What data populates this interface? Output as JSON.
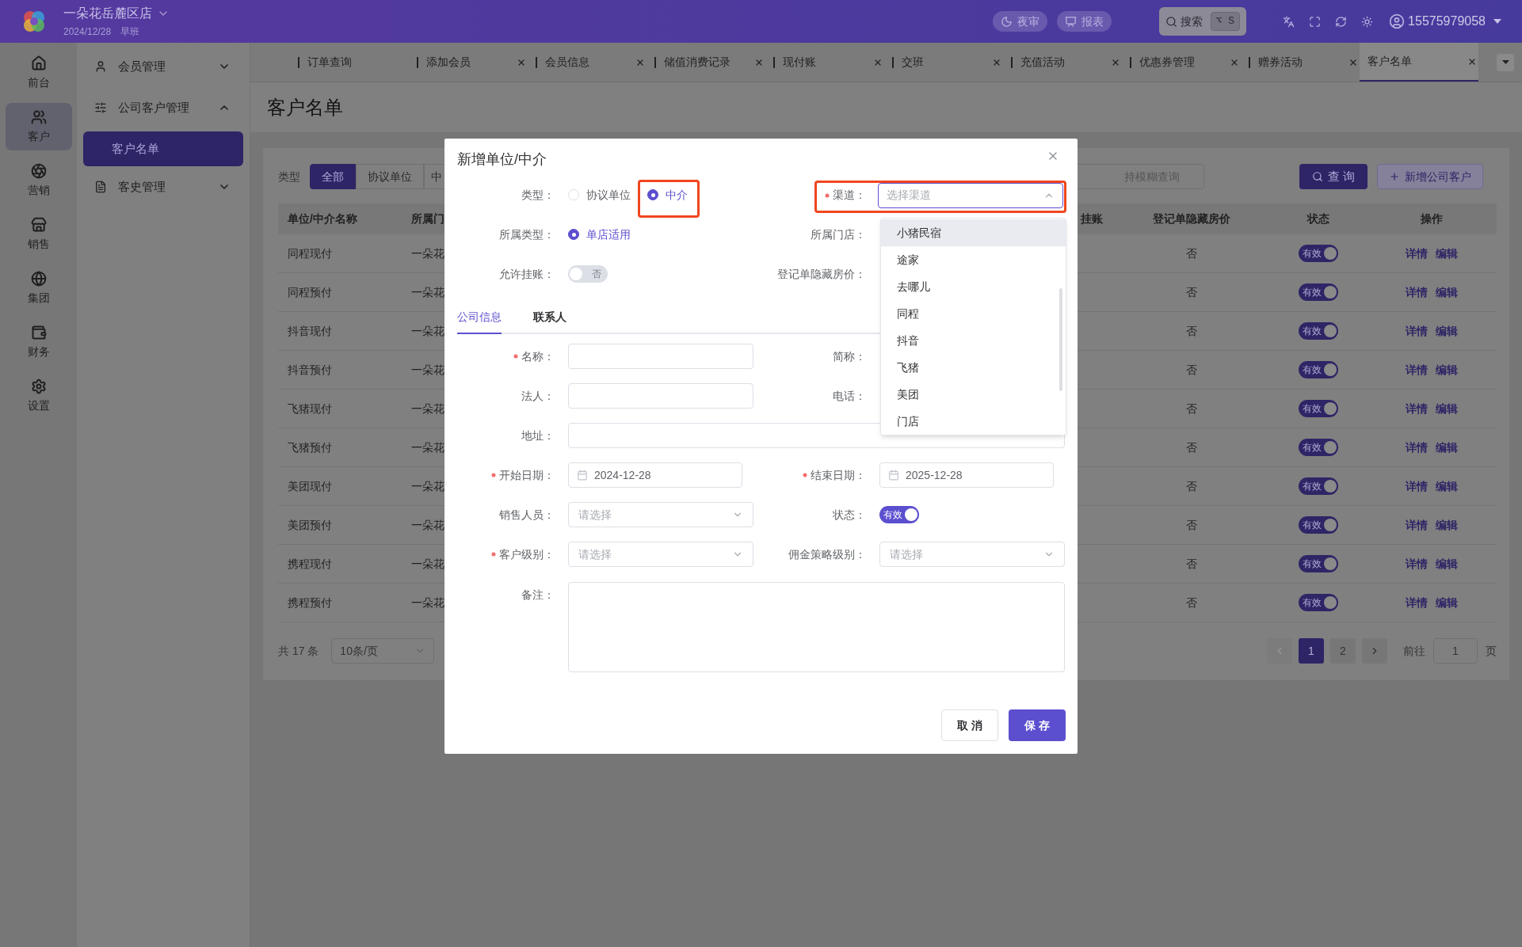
{
  "header": {
    "store": "一朵花岳麓区店",
    "date": "2024/12/28",
    "shift": "早班",
    "actions": [
      {
        "label": "夜审",
        "kind": "night"
      },
      {
        "label": "报表",
        "kind": "report"
      }
    ],
    "search": {
      "label": "搜索",
      "shortcut": "⌥ S"
    },
    "user": "15575979058"
  },
  "rail": [
    {
      "label": "前台",
      "kind": "home",
      "selected": false
    },
    {
      "label": "客户",
      "kind": "users",
      "selected": true
    },
    {
      "label": "营销",
      "kind": "aperture",
      "selected": false
    },
    {
      "label": "销售",
      "kind": "store",
      "selected": false
    },
    {
      "label": "集团",
      "kind": "globe",
      "selected": false
    },
    {
      "label": "财务",
      "kind": "wallet",
      "selected": false
    },
    {
      "label": "设置",
      "kind": "settings",
      "selected": false
    }
  ],
  "sidebar": [
    {
      "label": "会员管理",
      "kind": "user",
      "expanded": false
    },
    {
      "label": "公司客户管理",
      "kind": "sliders",
      "expanded": true,
      "children": [
        {
          "label": "客户名单",
          "selected": true
        }
      ]
    },
    {
      "label": "客史管理",
      "kind": "doc",
      "expanded": false
    }
  ],
  "tabs": [
    {
      "label": "订单查询",
      "closable": false,
      "selected": false
    },
    {
      "label": "添加会员",
      "closable": true,
      "selected": false
    },
    {
      "label": "会员信息",
      "closable": true,
      "selected": false
    },
    {
      "label": "储值消费记录",
      "closable": true,
      "selected": false
    },
    {
      "label": "现付账",
      "closable": true,
      "selected": false
    },
    {
      "label": "交班",
      "closable": true,
      "selected": false
    },
    {
      "label": "充值活动",
      "closable": true,
      "selected": false
    },
    {
      "label": "优惠券管理",
      "closable": true,
      "selected": false
    },
    {
      "label": "赠券活动",
      "closable": true,
      "selected": false
    },
    {
      "label": "客户名单",
      "closable": true,
      "selected": true
    }
  ],
  "page_title": "客户名单",
  "filter": {
    "label": "类型",
    "options": [
      {
        "label": "全部",
        "selected": true
      },
      {
        "label": "协议单位",
        "selected": false
      },
      {
        "label": "中",
        "selected": false
      }
    ],
    "search_placeholder": "持模糊查询",
    "query_button": "查 询",
    "add_button": "新增公司客户"
  },
  "table": {
    "columns": [
      "单位/中介名称",
      "所属门",
      "挂账",
      "登记单隐藏房价",
      "状态",
      "操作"
    ],
    "rows": [
      {
        "name": "同程现付",
        "store": "一朵花",
        "hide_price": "否",
        "status": {
          "label": "有效",
          "on": true
        },
        "actions": [
          "详情",
          "编辑"
        ]
      },
      {
        "name": "同程预付",
        "store": "一朵花",
        "hide_price": "否",
        "status": {
          "label": "有效",
          "on": true
        },
        "actions": [
          "详情",
          "编辑"
        ]
      },
      {
        "name": "抖音现付",
        "store": "一朵花",
        "hide_price": "否",
        "status": {
          "label": "有效",
          "on": true
        },
        "actions": [
          "详情",
          "编辑"
        ]
      },
      {
        "name": "抖音预付",
        "store": "一朵花",
        "hide_price": "否",
        "status": {
          "label": "有效",
          "on": true
        },
        "actions": [
          "详情",
          "编辑"
        ]
      },
      {
        "name": "飞猪现付",
        "store": "一朵花",
        "hide_price": "否",
        "status": {
          "label": "有效",
          "on": true
        },
        "actions": [
          "详情",
          "编辑"
        ]
      },
      {
        "name": "飞猪预付",
        "store": "一朵花",
        "hide_price": "否",
        "status": {
          "label": "有效",
          "on": true
        },
        "actions": [
          "详情",
          "编辑"
        ]
      },
      {
        "name": "美团现付",
        "store": "一朵花",
        "hide_price": "否",
        "status": {
          "label": "有效",
          "on": true
        },
        "actions": [
          "详情",
          "编辑"
        ]
      },
      {
        "name": "美团预付",
        "store": "一朵花",
        "hide_price": "否",
        "status": {
          "label": "有效",
          "on": true
        },
        "actions": [
          "详情",
          "编辑"
        ]
      },
      {
        "name": "携程现付",
        "store": "一朵花",
        "hide_price": "否",
        "status": {
          "label": "有效",
          "on": true
        },
        "actions": [
          "详情",
          "编辑"
        ]
      },
      {
        "name": "携程预付",
        "store": "一朵花",
        "hide_price": "否",
        "status": {
          "label": "有效",
          "on": true
        },
        "actions": [
          "详情",
          "编辑"
        ]
      }
    ]
  },
  "pagination": {
    "total": "共 17 条",
    "page_size": "10条/页",
    "prev_disabled": true,
    "pages": [
      {
        "label": "1",
        "selected": true
      },
      {
        "label": "2",
        "selected": false
      }
    ],
    "goto_label": "前往",
    "goto_value": "1",
    "goto_suffix": "页"
  },
  "dialog": {
    "title": "新增单位/中介",
    "type": {
      "label": "类型：",
      "options": [
        {
          "label": "协议单位",
          "selected": false,
          "highlighted": false
        },
        {
          "label": "中介",
          "selected": true,
          "highlighted": true
        }
      ]
    },
    "channel": {
      "label": "渠道：",
      "required": true,
      "placeholder": "选择渠道",
      "highlighted": true,
      "expanded": true,
      "options": [
        {
          "label": "小猪民宿",
          "hovered": true
        },
        {
          "label": "途家",
          "hovered": false
        },
        {
          "label": "去哪儿",
          "hovered": false
        },
        {
          "label": "同程",
          "hovered": false
        },
        {
          "label": "抖音",
          "hovered": false
        },
        {
          "label": "飞猪",
          "hovered": false
        },
        {
          "label": "美团",
          "hovered": false
        },
        {
          "label": "门店",
          "hovered": false
        }
      ]
    },
    "scope": {
      "label": "所属类型：",
      "options": [
        {
          "label": "单店适用",
          "selected": true
        }
      ]
    },
    "store_label": "所属门店：",
    "allow_credit": {
      "label": "允许挂账：",
      "on": false,
      "text": "否"
    },
    "hide_price_label": "登记单隐藏房价：",
    "tabs": [
      {
        "label": "公司信息",
        "selected": true
      },
      {
        "label": "联系人",
        "selected": false
      }
    ],
    "fields": [
      {
        "kind": "text",
        "label": "名称：",
        "required": true
      },
      {
        "kind": "covered",
        "label": "简称：",
        "required": false
      },
      {
        "kind": "text",
        "label": "法人：",
        "required": false
      },
      {
        "kind": "covered",
        "label": "电话：",
        "required": false
      },
      {
        "kind": "text",
        "label": "地址：",
        "required": false,
        "wide": true
      },
      {
        "kind": "date",
        "label": "开始日期：",
        "required": true,
        "value": "2024-12-28"
      },
      {
        "kind": "date",
        "label": "结束日期：",
        "required": true,
        "value": "2025-12-28"
      },
      {
        "kind": "select",
        "label": "销售人员：",
        "required": false,
        "placeholder": "请选择"
      },
      {
        "kind": "switch",
        "label": "状态：",
        "required": false,
        "on": true,
        "text": "有效"
      },
      {
        "kind": "select",
        "label": "客户级别：",
        "required": true,
        "placeholder": "请选择"
      },
      {
        "kind": "select",
        "label": "佣金策略级别：",
        "required": false,
        "placeholder": "请选择"
      },
      {
        "kind": "textarea",
        "label": "备注：",
        "required": false,
        "wide": true
      }
    ],
    "buttons": [
      {
        "label": "取 消",
        "kind": "default"
      },
      {
        "label": "保 存",
        "kind": "primary"
      }
    ]
  }
}
